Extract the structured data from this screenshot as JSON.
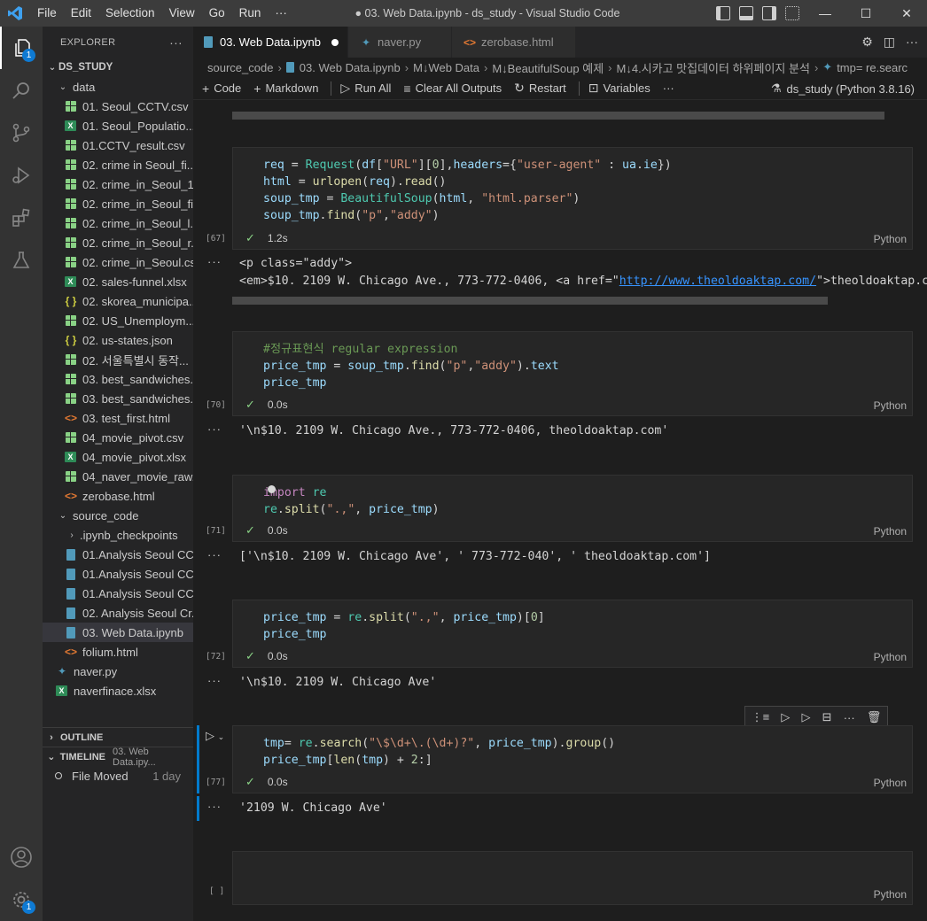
{
  "titlebar": {
    "menu": [
      "File",
      "Edit",
      "Selection",
      "View",
      "Go",
      "Run",
      "···"
    ],
    "title": "● 03. Web Data.ipynb - ds_study - Visual Studio Code"
  },
  "activity": {
    "explorer_badge": "1",
    "settings_badge": "1"
  },
  "sidebar": {
    "header": "EXPLORER",
    "root": "DS_STUDY",
    "data_folder": "data",
    "data_files": [
      {
        "name": "01. Seoul_CCTV.csv",
        "type": "csv"
      },
      {
        "name": "01. Seoul_Populatio...",
        "type": "xlsx"
      },
      {
        "name": "01.CCTV_result.csv",
        "type": "csv"
      },
      {
        "name": "02. crime in Seoul_fi...",
        "type": "csv"
      },
      {
        "name": "02. crime_in_Seoul_1...",
        "type": "csv"
      },
      {
        "name": "02. crime_in_Seoul_fi...",
        "type": "csv"
      },
      {
        "name": "02. crime_in_Seoul_l...",
        "type": "csv"
      },
      {
        "name": "02. crime_in_Seoul_r...",
        "type": "csv"
      },
      {
        "name": "02. crime_in_Seoul.csv",
        "type": "csv"
      },
      {
        "name": "02. sales-funnel.xlsx",
        "type": "xlsx"
      },
      {
        "name": "02. skorea_municipa...",
        "type": "json"
      },
      {
        "name": "02. US_Unemploym...",
        "type": "csv"
      },
      {
        "name": "02. us-states.json",
        "type": "json"
      },
      {
        "name": "02. 서울특별시 동작...",
        "type": "csv"
      },
      {
        "name": "03. best_sandwiches...",
        "type": "csv"
      },
      {
        "name": "03. best_sandwiches...",
        "type": "csv"
      },
      {
        "name": "03. test_first.html",
        "type": "html"
      },
      {
        "name": "04_movie_pivot.csv",
        "type": "csv"
      },
      {
        "name": "04_movie_pivot.xlsx",
        "type": "xlsx"
      },
      {
        "name": "04_naver_movie_raw...",
        "type": "csv"
      },
      {
        "name": "zerobase.html",
        "type": "html"
      }
    ],
    "source_folder": "source_code",
    "checkpoints_folder": ".ipynb_checkpoints",
    "source_files": [
      {
        "name": "01.Analysis Seoul CC...",
        "type": "nb"
      },
      {
        "name": "01.Analysis Seoul CC...",
        "type": "nb"
      },
      {
        "name": "01.Analysis Seoul CC...",
        "type": "nb"
      },
      {
        "name": "02. Analysis Seoul Cr...",
        "type": "nb"
      },
      {
        "name": "03. Web Data.ipynb",
        "type": "nb",
        "selected": true
      },
      {
        "name": "folium.html",
        "type": "html"
      }
    ],
    "root_files": [
      {
        "name": "naver.py",
        "type": "py"
      },
      {
        "name": "naverfinace.xlsx",
        "type": "xlsx"
      }
    ],
    "outline_label": "OUTLINE",
    "timeline_label": "TIMELINE",
    "timeline_file": "03. Web Data.ipy...",
    "timeline_entry": "File Moved",
    "timeline_time": "1 day"
  },
  "tabs": [
    {
      "label": "03. Web Data.ipynb",
      "active": true,
      "dirty": true
    },
    {
      "label": "naver.py"
    },
    {
      "label": "zerobase.html"
    }
  ],
  "breadcrumb": [
    "source_code",
    "03. Web Data.ipynb",
    "M↓Web Data",
    "M↓BeautifulSoup 예제",
    "M↓4.시카고 맛집데이터 하위페이지 분석",
    "tmp= re.searc"
  ],
  "toolbar": {
    "code": "Code",
    "markdown": "Markdown",
    "run_all": "Run All",
    "clear_outputs": "Clear All Outputs",
    "restart": "Restart",
    "variables": "Variables",
    "more": "···",
    "kernel": "ds_study (Python 3.8.16)"
  },
  "cells": [
    {
      "exec": "[67]",
      "time": "1.2s",
      "lang": "Python"
    },
    {
      "exec": "[70]",
      "time": "0.0s",
      "lang": "Python"
    },
    {
      "exec": "[71]",
      "time": "0.0s",
      "lang": "Python"
    },
    {
      "exec": "[72]",
      "time": "0.0s",
      "lang": "Python"
    },
    {
      "exec": "[77]",
      "time": "0.0s",
      "lang": "Python"
    },
    {
      "exec": "[ ]",
      "time": "",
      "lang": "Python"
    }
  ],
  "outputs": {
    "o67_line1": "<p class=\"addy\">",
    "o67_line2a": "<em>$10. 2109 W. Chicago Ave., 773-772-0406, <a href=\"",
    "o67_link": "http://www.theoldoaktap.com/",
    "o67_line2b": "\">theoldoaktap.co",
    "o70": "'\\n$10. 2109 W. Chicago Ave., 773-772-0406, theoldoaktap.com'",
    "o71": "['\\n$10. 2109 W. Chicago Ave', ' 773-772-040', ' theoldoaktap.com']",
    "o72": "'\\n$10. 2109 W. Chicago Ave'",
    "o77": "'2109 W. Chicago Ave'"
  }
}
